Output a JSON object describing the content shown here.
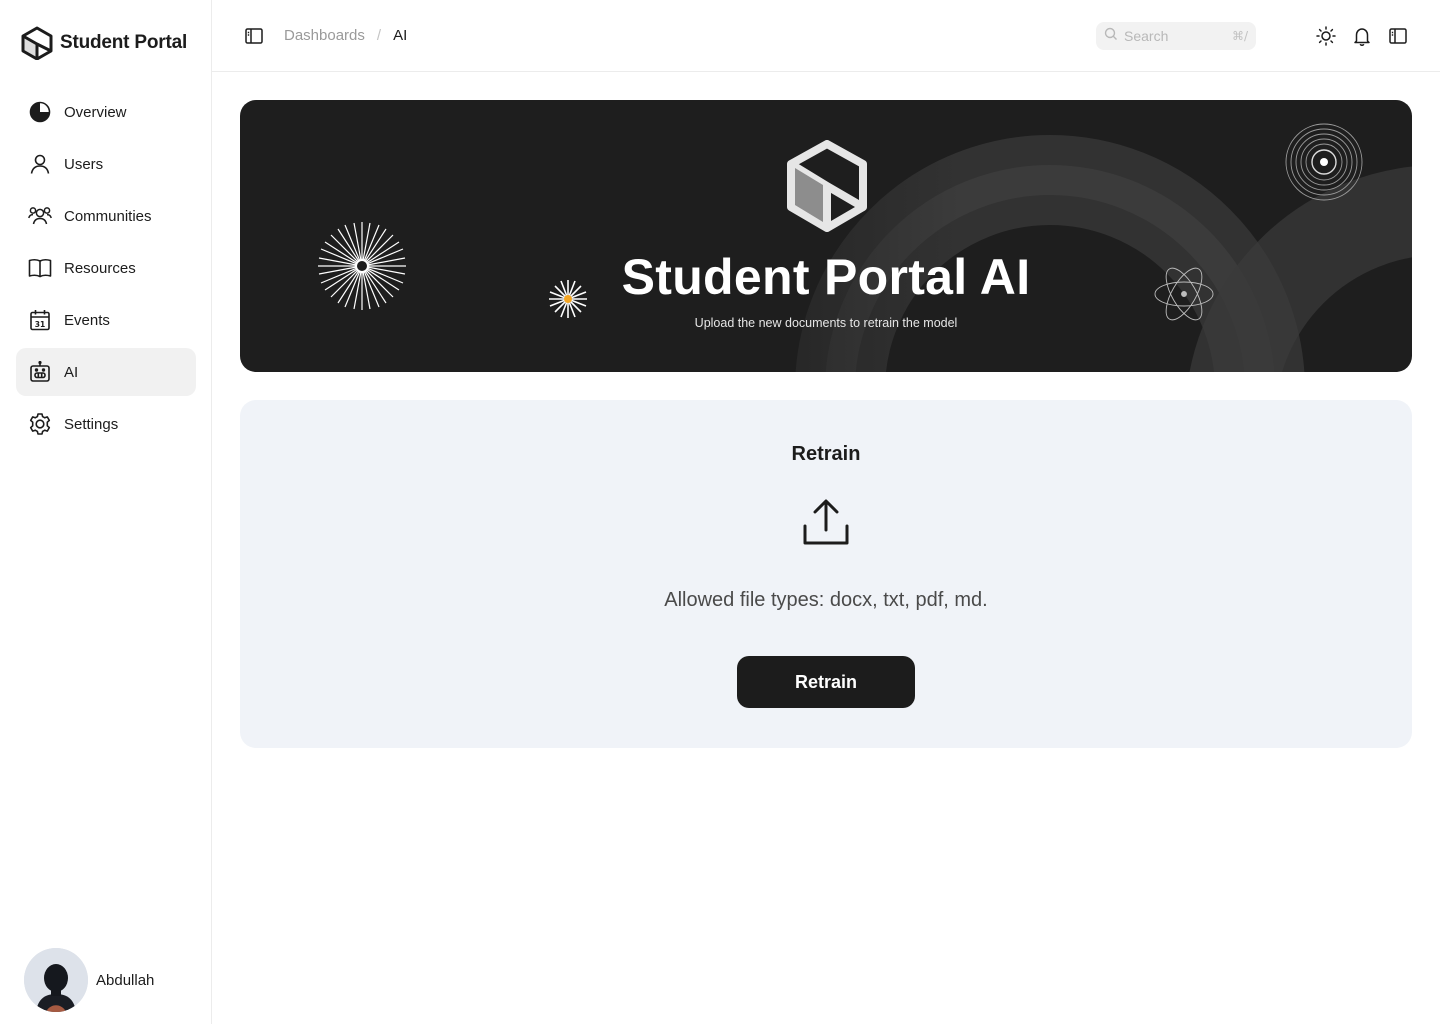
{
  "app": {
    "name": "Student Portal"
  },
  "sidebar": {
    "items": [
      {
        "label": "Overview",
        "icon": "pie-chart-icon"
      },
      {
        "label": "Users",
        "icon": "user-icon"
      },
      {
        "label": "Communities",
        "icon": "users-group-icon"
      },
      {
        "label": "Resources",
        "icon": "book-icon"
      },
      {
        "label": "Events",
        "icon": "calendar-icon"
      },
      {
        "label": "AI",
        "icon": "robot-icon",
        "active": true
      },
      {
        "label": "Settings",
        "icon": "gear-icon"
      }
    ],
    "user": {
      "name": "Abdullah"
    }
  },
  "header": {
    "breadcrumb": [
      "Dashboards",
      "AI"
    ],
    "breadcrumb_separator": "/",
    "search": {
      "placeholder": "Search",
      "shortcut": "⌘/"
    },
    "icons": [
      "sun-icon",
      "bell-icon",
      "sidebar-toggle-icon"
    ]
  },
  "banner": {
    "title": "Student Portal AI",
    "subtitle": "Upload the new documents to retrain the model"
  },
  "retrain": {
    "title": "Retrain",
    "allowed_types": "Allowed file types: docx, txt, pdf, md.",
    "button_label": "Retrain"
  },
  "colors": {
    "active_nav_bg": "#f1f1f1",
    "banner_bg": "#1e1e1e",
    "card_bg": "#f0f3f8",
    "button_bg": "#1c1c1c",
    "accent_orange": "#f5a623"
  }
}
